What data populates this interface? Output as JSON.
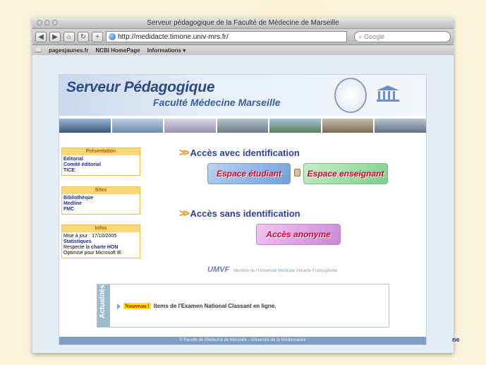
{
  "browser": {
    "title": "Serveur pédagogique de la Faculté de Médecine de Marseille",
    "url": "http://medidacte.timone.univ-mrs.fr/",
    "search_placeholder": "Google",
    "bookmarks": [
      "pagesjaunes.fr",
      "NCBI HomePage",
      "Informations ▾"
    ]
  },
  "site": {
    "title": "Serveur Pédagogique",
    "subtitle": "Faculté Médecine Marseille"
  },
  "sidebar": {
    "presentation": {
      "header": "Présentation",
      "items": [
        "Editorial",
        "Comité éditorial",
        "TICE"
      ]
    },
    "sites": {
      "header": "Sites",
      "items": [
        "Bibliothèque",
        "Medline",
        "FMC"
      ]
    },
    "infos": {
      "header": "Infos",
      "line1": "Mise à jour : 17/10/2005",
      "line2": "Statistiques",
      "line3_prefix": "Respecte la ",
      "line3_link": "charte HON",
      "line4": "Optimisé pour Microsoft IE"
    }
  },
  "access": {
    "with_id_heading": "Accès avec identification",
    "student_button": "Espace étudiant",
    "teacher_button": "Espace enseignant",
    "without_id_heading": "Accès sans identification",
    "anonymous_button": "Accès anonyme"
  },
  "umvf": {
    "logo": "UMVF",
    "caption": "Membre de l'Université Médicale Virtuelle Francophone"
  },
  "news": {
    "side_label": "Actualités",
    "badge": "Nouveau !",
    "text": "Items de l'Examen National Classant en ligne."
  },
  "footer": {
    "text": "© Faculté de Médecine de Marseille - Université de la Méditerranée"
  },
  "fragment": {
    "text": "ne"
  }
}
